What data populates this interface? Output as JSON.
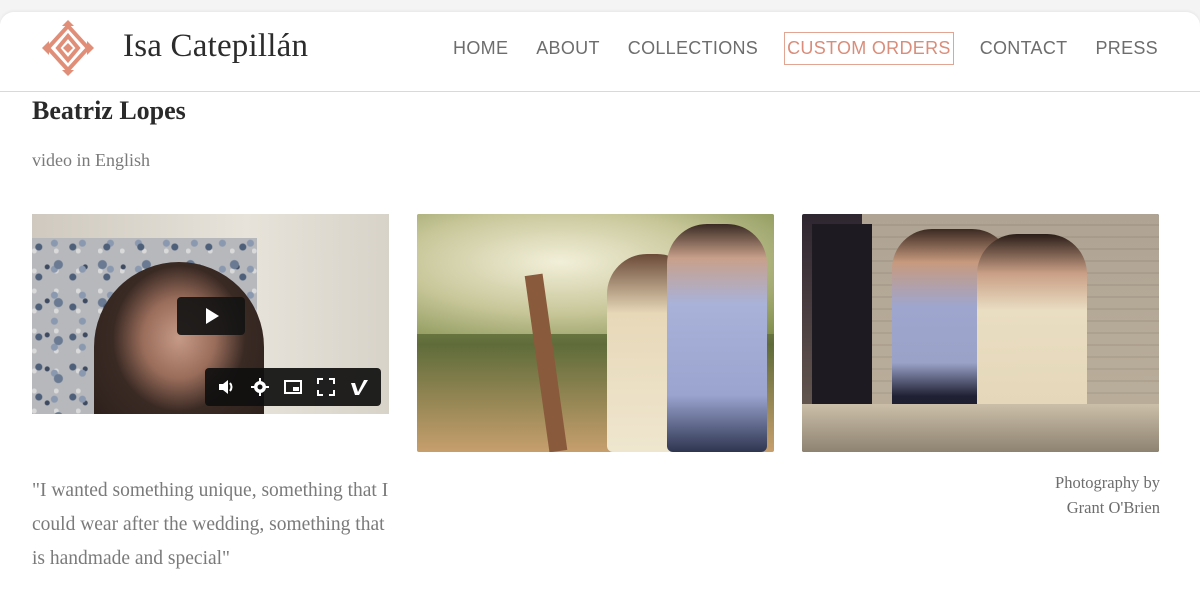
{
  "header": {
    "brand": "Isa Catepillán",
    "logo_icon": "diamond-motif-icon",
    "accent_color": "#d98d7a",
    "nav": [
      {
        "label": "HOME",
        "active": false
      },
      {
        "label": "ABOUT",
        "active": false
      },
      {
        "label": "COLLECTIONS",
        "active": false
      },
      {
        "label": "CUSTOM ORDERS",
        "active": true
      },
      {
        "label": "CONTACT",
        "active": false
      },
      {
        "label": "PRESS",
        "active": false
      }
    ]
  },
  "main": {
    "name": "Beatriz Lopes",
    "subtitle": "video in English",
    "video": {
      "play_icon": "play-icon",
      "controls": [
        "volume-icon",
        "settings-icon",
        "picture-in-picture-icon",
        "fullscreen-icon",
        "vimeo-icon"
      ]
    },
    "quote": "\"I wanted something unique, something that I could wear after the wedding, something that is handmade and special\"",
    "credit_line1": "Photography by",
    "credit_line2": "Grant O'Brien"
  }
}
